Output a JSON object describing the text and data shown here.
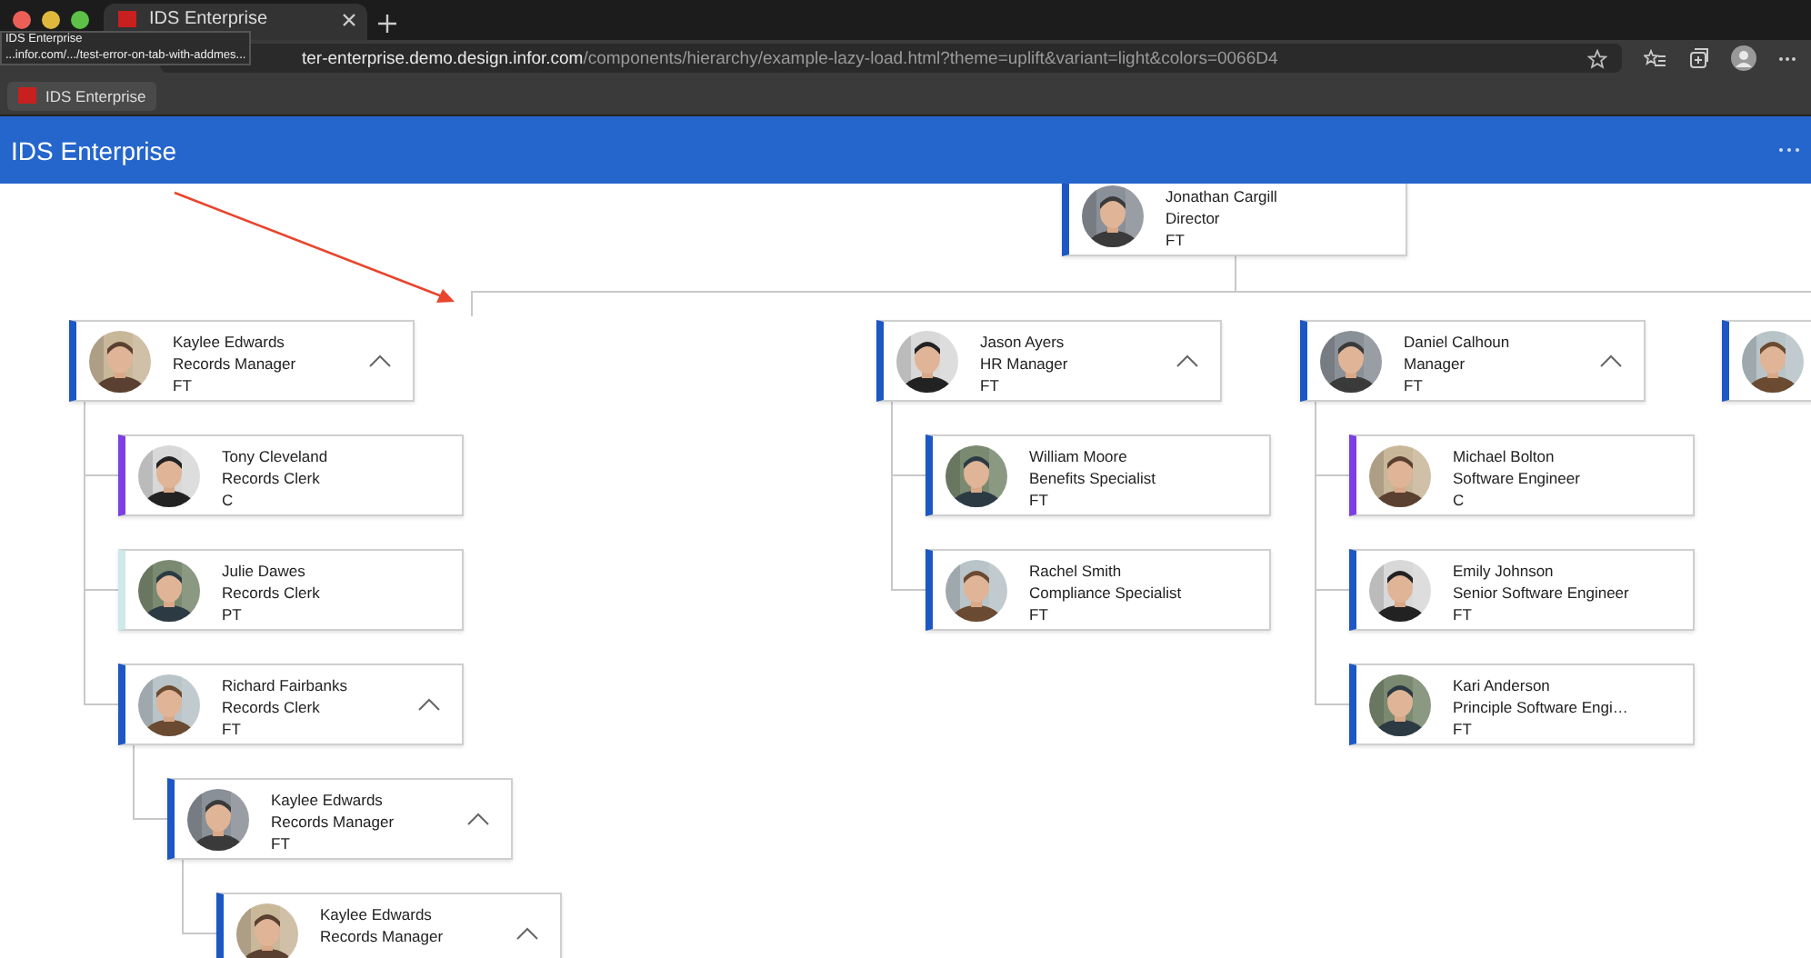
{
  "browser": {
    "tab": {
      "title": "IDS Enterprise"
    },
    "tooltip": {
      "title": "IDS Enterprise",
      "url": "...infor.com/.../test-error-on-tab-with-addmes..."
    },
    "address": {
      "host": "ter-enterprise.demo.design.infor.com",
      "path": "/components/hierarchy/example-lazy-load.html?theme=uplift&variant=light&colors=0066D4"
    },
    "bookmarks": [
      {
        "label": "IDS Enterprise"
      }
    ]
  },
  "app": {
    "title": "IDS Enterprise"
  },
  "hierarchy": {
    "root": {
      "name": "Jonathan Cargill",
      "title": "Director",
      "type": "FT",
      "color": "#1c57c4",
      "children": [
        {
          "name": "Kaylee Edwards",
          "title": "Records Manager",
          "type": "FT",
          "color": "#1c57c4",
          "expanded": true,
          "children": [
            {
              "name": "Tony Cleveland",
              "title": "Records Clerk",
              "type": "C",
              "color": "#7b3fe4"
            },
            {
              "name": "Julie Dawes",
              "title": "Records Clerk",
              "type": "PT",
              "color": "#cde9ea"
            },
            {
              "name": "Richard Fairbanks",
              "title": "Records Clerk",
              "type": "FT",
              "color": "#1c57c4",
              "expanded": true,
              "children": [
                {
                  "name": "Kaylee Edwards",
                  "title": "Records Manager",
                  "type": "FT",
                  "color": "#1c57c4",
                  "expanded": true,
                  "children": [
                    {
                      "name": "Kaylee Edwards",
                      "title": "Records Manager",
                      "color": "#1c57c4",
                      "expanded": true
                    }
                  ]
                }
              ]
            }
          ]
        },
        {
          "name": "Jason Ayers",
          "title": "HR Manager",
          "type": "FT",
          "color": "#1c57c4",
          "expanded": true,
          "children": [
            {
              "name": "William Moore",
              "title": "Benefits Specialist",
              "type": "FT",
              "color": "#1c57c4"
            },
            {
              "name": "Rachel Smith",
              "title": "Compliance Specialist",
              "type": "FT",
              "color": "#1c57c4"
            }
          ]
        },
        {
          "name": "Daniel Calhoun",
          "title": "Manager",
          "type": "FT",
          "color": "#1c57c4",
          "expanded": true,
          "children": [
            {
              "name": "Michael Bolton",
              "title": "Software Engineer",
              "type": "C",
              "color": "#7b3fe4"
            },
            {
              "name": "Emily Johnson",
              "title": "Senior Software Engineer",
              "type": "FT",
              "color": "#1c57c4"
            },
            {
              "name": "Kari Anderson",
              "title": "Principle Software Engi…",
              "type": "FT",
              "color": "#1c57c4"
            }
          ]
        },
        {
          "color": "#1c57c4"
        }
      ]
    }
  }
}
